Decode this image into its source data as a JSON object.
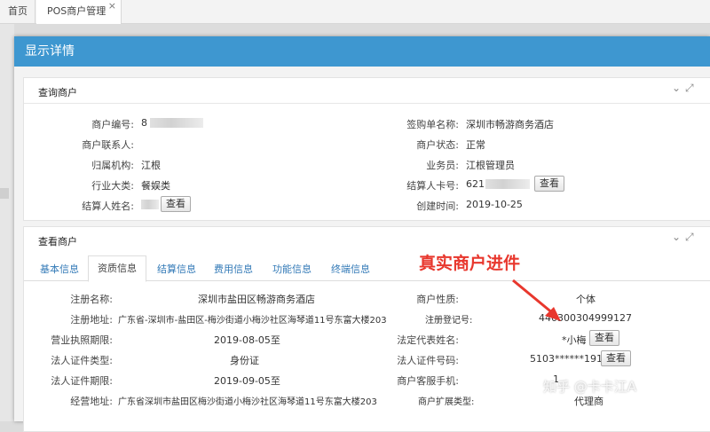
{
  "tabs": {
    "home": "首页",
    "active": "POS商户管理",
    "close": "×"
  },
  "modal": {
    "title": "显示详情"
  },
  "panel1": {
    "title": "查询商户",
    "ctrl_collapse": "⌄",
    "ctrl_expand": "⤢",
    "fields": {
      "merchant_no_label": "商户编号:",
      "merchant_no_value": "8",
      "sign_name_label": "签购单名称:",
      "sign_name_value": "深圳市畅游商务酒店",
      "contact_label": "商户联系人:",
      "contact_value": "",
      "status_label": "商户状态:",
      "status_value": "正常",
      "org_label": "归属机构:",
      "org_value": "江根",
      "salesman_label": "业务员:",
      "salesman_value": "江根管理员",
      "industry_label": "行业大类:",
      "industry_value": "餐娱类",
      "card_label": "结算人卡号:",
      "card_value": "621",
      "settler_label": "结算人姓名:",
      "settler_value": "",
      "created_label": "创建时间:",
      "created_value": "2019-10-25"
    },
    "view_button": "查看"
  },
  "panel2": {
    "title": "查看商户",
    "subtabs": [
      "基本信息",
      "资质信息",
      "结算信息",
      "费用信息",
      "功能信息",
      "终端信息"
    ],
    "active_tab": "资质信息",
    "fields": {
      "reg_name_label": "注册名称:",
      "reg_name_value": "深圳市盐田区畅游商务酒店",
      "nature_label": "商户性质:",
      "nature_value": "个体",
      "reg_addr_label": "注册地址:",
      "reg_addr_value": "广东省-深圳市-盐田区-梅沙街道小梅沙社区海琴道11号东富大楼203",
      "reg_no_label": "注册登记号:",
      "reg_no_value": "440300304999127",
      "license_label": "营业执照期限:",
      "license_value": "2019-08-05至",
      "legal_name_label": "法定代表姓名:",
      "legal_name_value": "*小梅",
      "id_type_label": "法人证件类型:",
      "id_type_value": "身份证",
      "id_no_label": "法人证件号码:",
      "id_no_value": "5103******191X",
      "id_exp_label": "法人证件期限:",
      "id_exp_value": "2019-09-05至",
      "cs_phone_label": "商户客服手机:",
      "cs_phone_value": "1",
      "biz_addr_label": "经营地址:",
      "biz_addr_value": "广东省深圳市盐田区梅沙街道小梅沙社区海琴道11号东富大楼203",
      "expand_type_label": "商户扩展类型:",
      "expand_type_value": "代理商"
    },
    "view_button": "查看"
  },
  "annotation": "真实商户进件",
  "watermark": "知乎 @卡卡江A",
  "colors": {
    "header": "#3e97d0",
    "annotation": "#e8372d",
    "link": "#337ab7"
  }
}
